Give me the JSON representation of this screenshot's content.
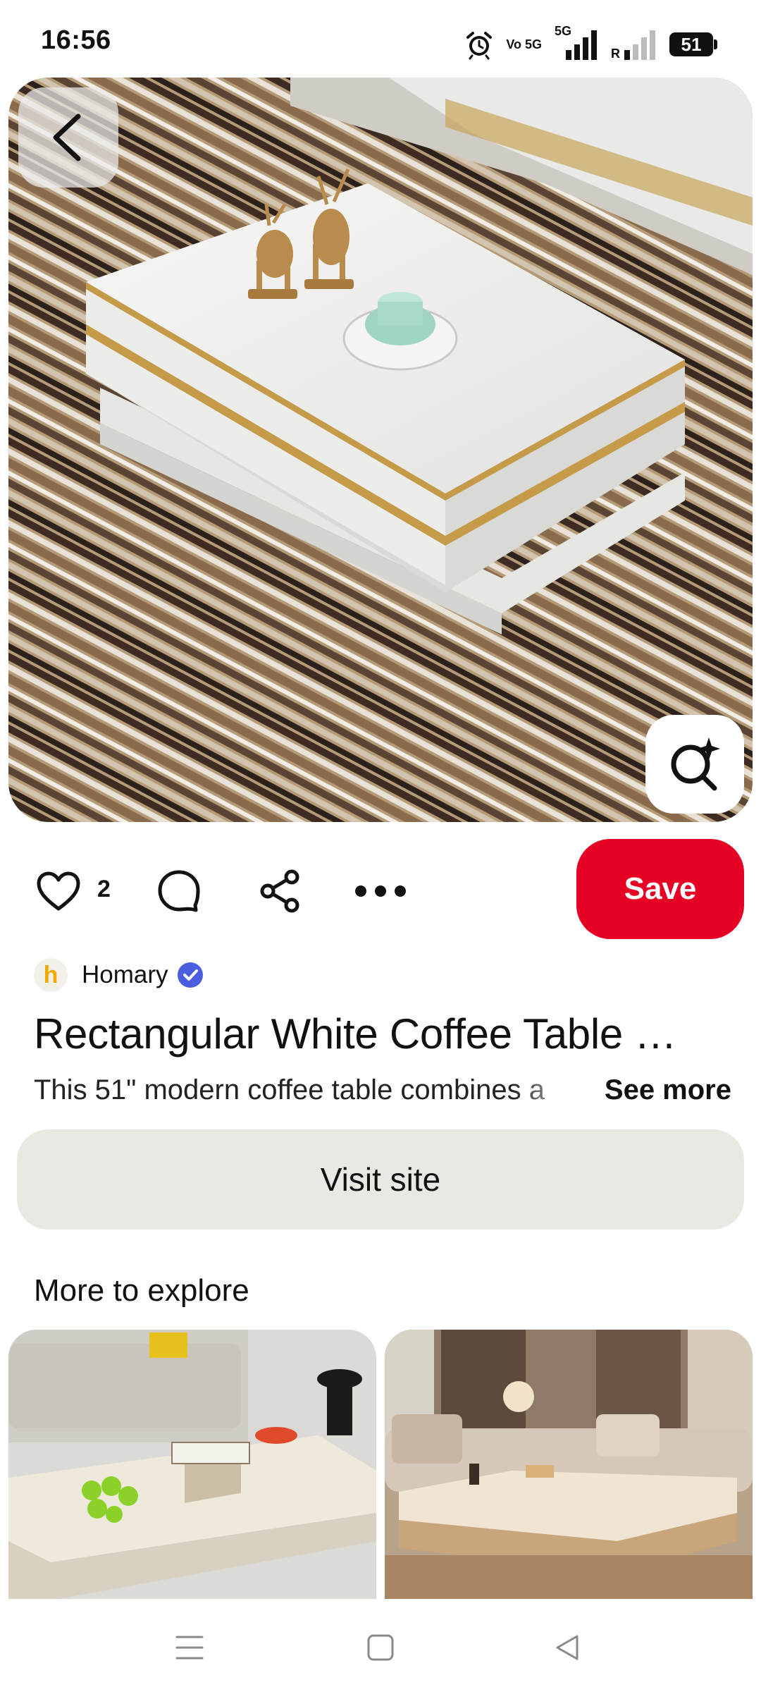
{
  "status_bar": {
    "time": "16:56",
    "net_volte": "Vo 5G",
    "net_type": "5G",
    "roaming": "R",
    "battery": "51",
    "icons": [
      "alarm-icon",
      "volte-icon",
      "signal-icon",
      "signal-weak-icon",
      "battery-icon"
    ]
  },
  "pin": {
    "back_icon": "chevron-left-icon",
    "visual_search_icon": "sparkle-search-icon",
    "like_count": "2",
    "save_label": "Save",
    "creator": "Homary",
    "creator_initial": "h",
    "title": "Rectangular White Coffee Table …",
    "description": "This 51\" modern coffee table combines a",
    "see_more": "See more",
    "visit_label": "Visit site"
  },
  "explore": {
    "title": "More to explore"
  },
  "colors": {
    "save_red": "#e60023",
    "visit_bg": "#e9e9e4",
    "verified_blue": "#4a5fe0"
  }
}
